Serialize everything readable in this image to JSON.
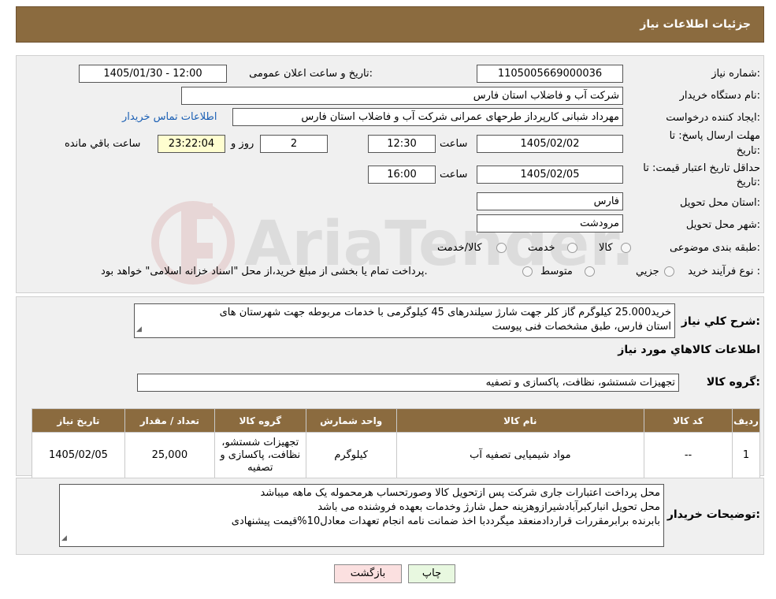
{
  "header": {
    "title": "جزئیات اطلاعات نیاز"
  },
  "form": {
    "need_number_label": "شماره نیاز:",
    "need_number_value": "1105005669000036",
    "announce_label": "تاریخ و ساعت اعلان عمومی:",
    "announce_value": "1405/01/30 - 12:00",
    "buyer_org_label": "نام دستگاه خریدار:",
    "buyer_org_value": "شرکت آب و فاضلاب استان فارس",
    "requester_label": "ایجاد کننده درخواست:",
    "requester_value": "مهرداد شبانی کارپرداز طرحهای عمرانی  شرکت آب و فاضلاب استان فارس",
    "contact_link": "اطلاعات تماس خریدار",
    "reply_deadline_label_1": "مهلت ارسال پاسخ: تا",
    "reply_deadline_label_2": "تاریخ:",
    "reply_date": "1405/02/02",
    "time_label": "ساعت",
    "reply_time": "12:30",
    "days_value": "2",
    "days_label": "روز و",
    "remaining_time": "23:22:04",
    "remaining_label": "ساعت باقي مانده",
    "price_validity_label_1": "حداقل تاریخ اعتبار قیمت: تا",
    "price_validity_label_2": "تاریخ:",
    "price_validity_date": "1405/02/05",
    "price_validity_time": "16:00",
    "province_label": "استان محل تحویل:",
    "province_value": "فارس",
    "city_label": "شهر محل تحویل:",
    "city_value": "مرودشت",
    "category_label": "طبقه بندی موضوعی:",
    "category_options": [
      "کالا",
      "خدمت",
      "کالا/خدمت"
    ],
    "process_label": "نوع فرآیند خرید :",
    "process_options": [
      "جزيي",
      "متوسط"
    ],
    "process_note": "پرداخت تمام یا بخشی از مبلغ خرید،از محل \"اسناد خزانه اسلامی\" خواهد بود."
  },
  "summary": {
    "label": "شرح کلي نياز:",
    "text_line1": "خرید25.000 کیلوگرم گاز کلر جهت شارژ سیلندرهای 45 کیلوگرمی با خدمات مربوطه جهت شهرستان های",
    "text_line2": "استان فارس، طبق مشخصات فنی پیوست",
    "goods_info_title": "اطلاعات کالاهاي مورد نياز",
    "group_label": "گروه کالا:",
    "group_value": "تجهیزات شستشو، نظافت، پاکسازی و تصفیه"
  },
  "table": {
    "headers": [
      "رديف",
      "کد کالا",
      "نام کالا",
      "واحد شمارش",
      "گروه کالا",
      "تعداد / مقدار",
      "تاریخ نیاز"
    ],
    "rows": [
      [
        "1",
        "--",
        "مواد شیمیایی تصفیه آب",
        "کیلوگرم",
        "تجهیزات شستشو، نظافت، پاکسازی و تصفیه",
        "25,000",
        "1405/02/05"
      ]
    ]
  },
  "buyer_notes": {
    "label": "توضیحات خریدار:",
    "line1": "محل پرداخت اعتبارات جاری شرکت پس ازتحویل کالا وصورتحساب هرمحموله یک ماهه میباشد",
    "line2": "محل تحویل انبارکبرآبادشیرازوهزینه حمل شارژ وخدمات بعهده فروشنده می باشد",
    "line3": "بابرنده برابرمقررات قراردادمنعقد میگرددبا اخذ ضمانت نامه انجام تعهدات معادل10%قیمت پیشنهادی"
  },
  "buttons": {
    "print": "چاپ",
    "back": "بازگشت"
  },
  "watermark": {
    "text": "AriaTender.neT"
  },
  "colors": {
    "header_brown": "#8b6b3f",
    "link_blue": "#1a5fb4",
    "back_button_bg": "#fbe0e0",
    "print_button_bg": "#e8f8e0"
  }
}
